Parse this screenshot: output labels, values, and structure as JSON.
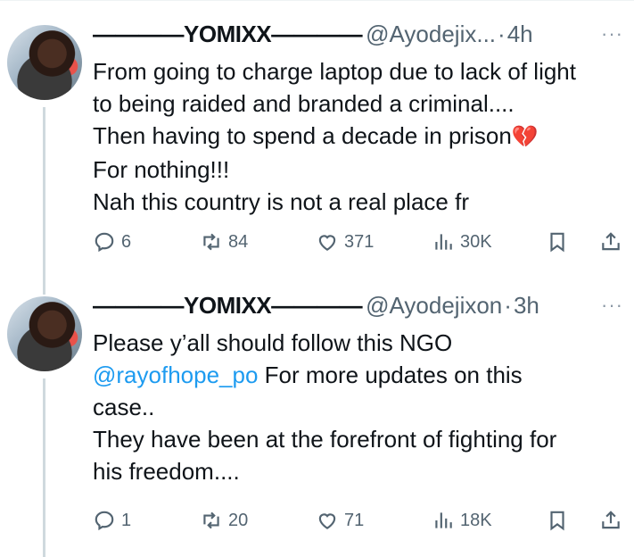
{
  "tweets": [
    {
      "display_name": "————YOMIXX————",
      "handle": "@Ayodejix...",
      "separator": "·",
      "time": "4h",
      "more": "···",
      "lines": [
        "From going to charge laptop due to lack of light",
        "to being raided and branded a criminal....",
        "Then having to spend a decade in prison",
        "For nothing!!!",
        "Nah this country is not a real place fr"
      ],
      "emoji": "💔",
      "replies": "6",
      "retweets": "84",
      "likes": "371",
      "views": "30K"
    },
    {
      "display_name": "————YOMIXX————",
      "handle": "@Ayodejixon",
      "separator": "·",
      "time": "3h",
      "more": "···",
      "line1": "Please y’all should follow this NGO",
      "mention": "@rayofhope_po",
      "line2_rest": " For more updates on this",
      "line3": "case..",
      "line4": "They have been at the forefront of fighting for",
      "line5": "his freedom....",
      "replies": "1",
      "retweets": "20",
      "likes": "71",
      "views": "18K"
    }
  ],
  "icons": {
    "reply": "reply-icon",
    "retweet": "retweet-icon",
    "like": "heart-icon",
    "views": "views-icon",
    "bookmark": "bookmark-icon",
    "share": "share-icon"
  }
}
